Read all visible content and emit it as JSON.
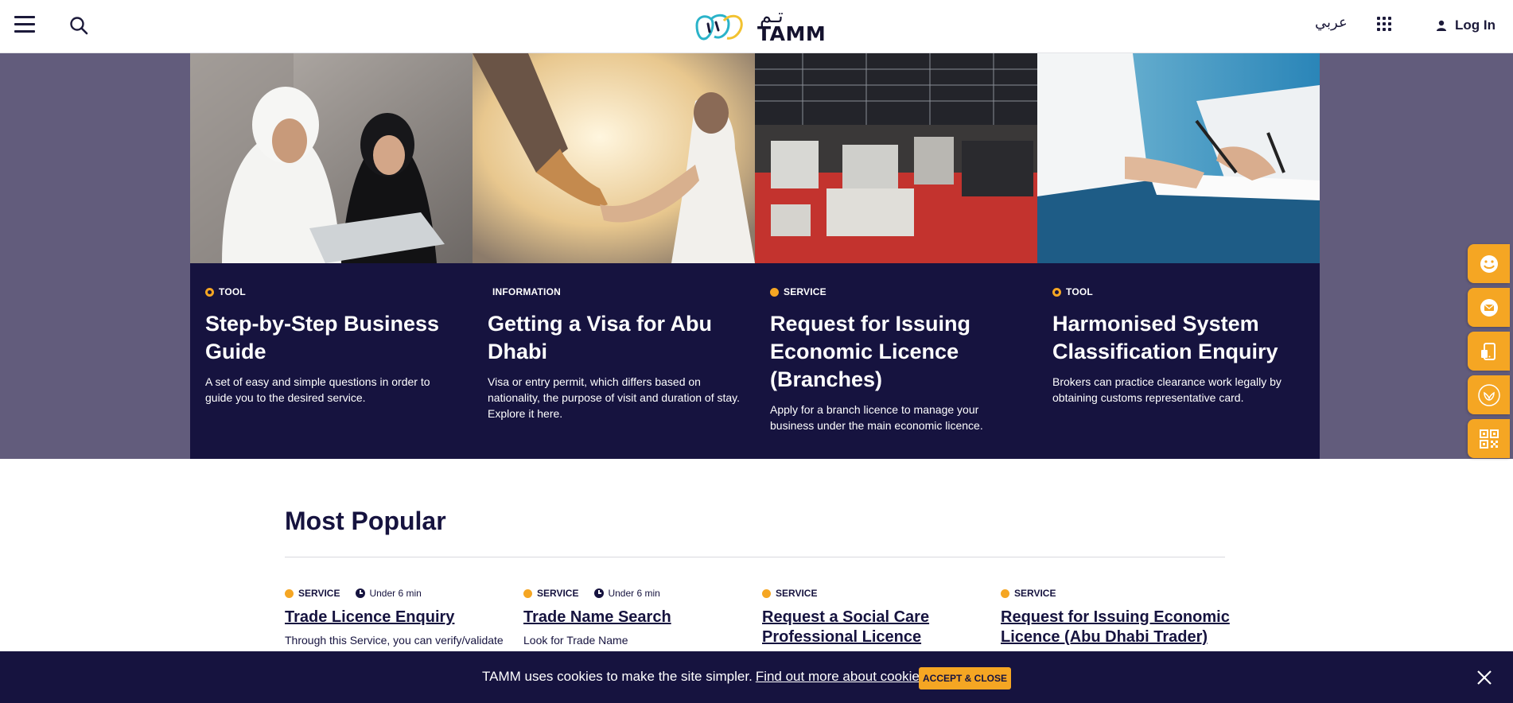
{
  "header": {
    "logo_text": "TAMM",
    "logo_arabic": "تـم",
    "language_label": "عربي",
    "login_label": "Log In"
  },
  "hero_cards": [
    {
      "tag": "TOOL",
      "title": "Step-by-Step Business Guide",
      "description": "A set of easy and simple questions in order to guide you to the desired service."
    },
    {
      "tag": "INFORMATION",
      "title": "Getting a Visa for Abu Dhabi",
      "description": "Visa or entry permit, which differs based on nationality, the purpose of visit and duration of stay. Explore it here."
    },
    {
      "tag": "SERVICE",
      "title": "Request for Issuing Economic Licence (Branches)",
      "description": "Apply for a branch licence to manage your business under the main economic licence."
    },
    {
      "tag": "TOOL",
      "title": "Harmonised System Classification Enquiry",
      "description": "Brokers can practice clearance work legally by obtaining customs representative card."
    }
  ],
  "most_popular": {
    "title": "Most Popular",
    "items": [
      {
        "kind": "SERVICE",
        "duration": "Under 6 min",
        "title": "Trade Licence Enquiry",
        "description": "Through this Service, you can verify/validate"
      },
      {
        "kind": "SERVICE",
        "duration": "Under 6 min",
        "title": "Trade Name Search",
        "description": "Look for Trade Name"
      },
      {
        "kind": "SERVICE",
        "duration": "",
        "title": "Request a Social Care Professional Licence",
        "description": ""
      },
      {
        "kind": "SERVICE",
        "duration": "",
        "title": "Request for Issuing Economic Licence (Abu Dhabi Trader)",
        "description": ""
      }
    ]
  },
  "cookie": {
    "text": "TAMM uses cookies to make the site simpler.",
    "link": "Find out more about cookies",
    "accept": "ACCEPT & CLOSE"
  },
  "floating_buttons": [
    "smiley-icon",
    "mail-icon",
    "mobile-app-icon",
    "emblem-icon",
    "qr-code-icon"
  ],
  "colors": {
    "navy": "#16133f",
    "accent": "#f5a623",
    "hero_backdrop": "#625c7c"
  }
}
